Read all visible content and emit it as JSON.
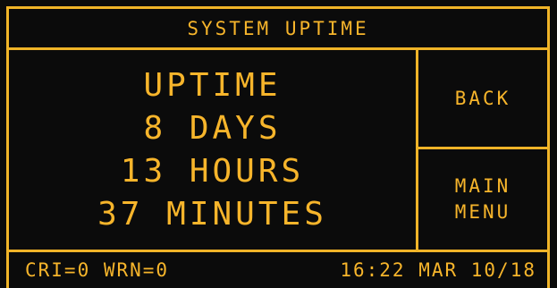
{
  "header": {
    "title": "SYSTEM UPTIME"
  },
  "uptime": {
    "label": "UPTIME",
    "days": "8 DAYS",
    "hours": "13 HOURS",
    "minutes": "37 MINUTES"
  },
  "buttons": {
    "back": "BACK",
    "main_menu_line1": "MAIN",
    "main_menu_line2": "MENU"
  },
  "status": {
    "alarms": "CRI=0 WRN=0",
    "datetime": "16:22 MAR 10/18"
  },
  "colors": {
    "accent": "#f0b428",
    "text": "#f7b52b",
    "background": "#0b0b0b"
  }
}
